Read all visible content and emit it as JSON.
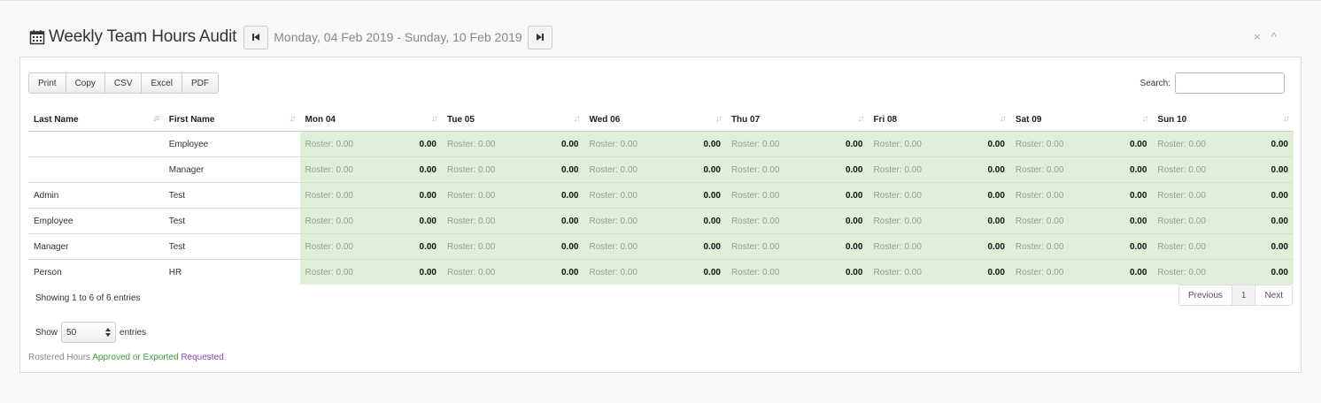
{
  "header": {
    "title": "Weekly Team Hours Audit",
    "date_range": "Monday, 04 Feb 2019 - Sunday, 10 Feb 2019",
    "close_glyph": "×",
    "collapse_glyph": "^"
  },
  "toolbar": {
    "print": "Print",
    "copy": "Copy",
    "csv": "CSV",
    "excel": "Excel",
    "pdf": "PDF"
  },
  "search": {
    "label": "Search:",
    "value": ""
  },
  "table": {
    "columns": [
      "Last Name",
      "First Name",
      "Mon 04",
      "Tue 05",
      "Wed 06",
      "Thu 07",
      "Fri 08",
      "Sat 09",
      "Sun 10"
    ],
    "rows": [
      {
        "last": "",
        "first": "Employee",
        "roster": "Roster: 0.00",
        "hours": "0.00"
      },
      {
        "last": "",
        "first": "Manager",
        "roster": "Roster: 0.00",
        "hours": "0.00"
      },
      {
        "last": "Admin",
        "first": "Test",
        "roster": "Roster: 0.00",
        "hours": "0.00"
      },
      {
        "last": "Employee",
        "first": "Test",
        "roster": "Roster: 0.00",
        "hours": "0.00"
      },
      {
        "last": "Manager",
        "first": "Test",
        "roster": "Roster: 0.00",
        "hours": "0.00"
      },
      {
        "last": "Person",
        "first": "HR",
        "roster": "Roster: 0.00",
        "hours": "0.00"
      }
    ]
  },
  "info": "Showing 1 to 6 of 6 entries",
  "pagination": {
    "previous": "Previous",
    "page": "1",
    "next": "Next"
  },
  "length": {
    "show": "Show",
    "value": "50",
    "entries": "entries"
  },
  "legend": {
    "rostered": "Rostered Hours",
    "approved": "Approved or Exported",
    "requested": "Requested"
  },
  "colors": {
    "day_bg": "#dff0d8",
    "approved": "#3c9a3c",
    "requested": "#8a44b4"
  }
}
